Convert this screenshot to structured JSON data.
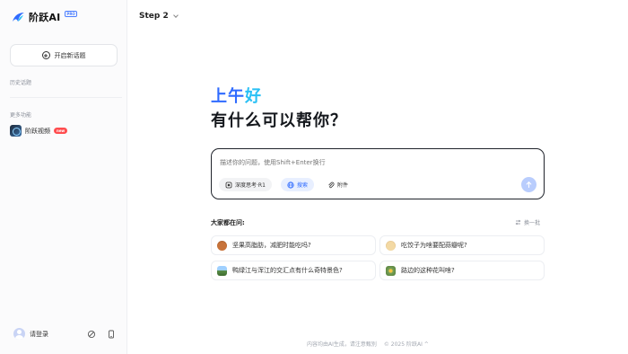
{
  "sidebar": {
    "brand": {
      "name": "阶跃AI",
      "badge": "PRO"
    },
    "new_chat_label": "开启新话题",
    "history_label": "历史话题",
    "more_label": "更多功能",
    "features": [
      {
        "label": "阶跃视频",
        "badge": "new"
      }
    ],
    "login_label": "请登录"
  },
  "header": {
    "step_label": "Step 2"
  },
  "main": {
    "greeting_part1": "上午",
    "greeting_part2": "好",
    "question": "有什么可以帮你？",
    "input": {
      "placeholder": "描述你的问题，使用Shift+Enter换行",
      "chips": [
        {
          "label": "深度思考·R1",
          "icon": "brain-icon"
        },
        {
          "label": "搜索",
          "icon": "globe-icon"
        },
        {
          "label": "附件",
          "icon": "paperclip-icon"
        }
      ]
    },
    "suggestions_title": "大家都在问:",
    "refresh_label": "换一批",
    "suggestions": [
      {
        "text": "坚果高脂肪，减肥时能吃吗?",
        "icon": "nut-icon"
      },
      {
        "text": "吃饺子为啥要配蒜瓣呢?",
        "icon": "dumpling-icon"
      },
      {
        "text": "鸭绿江与浑江的交汇点有什么奇特景色?",
        "icon": "scenery-icon"
      },
      {
        "text": "路边的这种花叫啥?",
        "icon": "flower-icon"
      }
    ]
  },
  "footer": {
    "disclaimer": "内容均由AI生成，请注意甄别",
    "copyright": "© 2025 阶跃AI ^"
  },
  "colors": {
    "accent": "#2f6bff",
    "accent_light": "#29c0f5",
    "send_disabled": "#b9cdfd",
    "new_badge": "#ff4d4f"
  }
}
